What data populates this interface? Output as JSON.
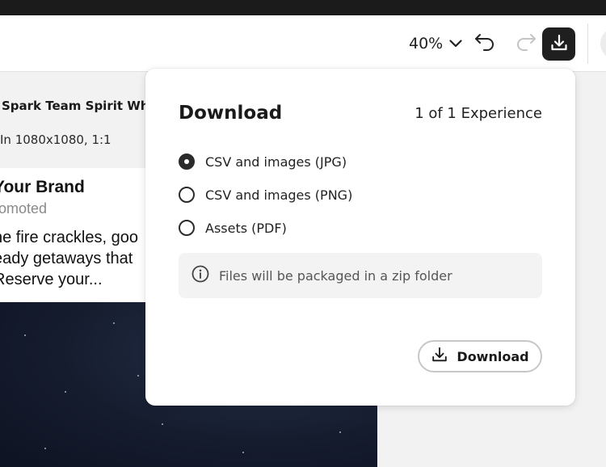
{
  "toolbar": {
    "zoom_value": "40%",
    "zoom_icon": "chevron-down-icon",
    "undo_icon": "undo-icon",
    "redo_icon": "redo-icon",
    "download_icon": "download-icon"
  },
  "canvas": {
    "design_title": "Spark Team Spirit Wher",
    "design_size": "In 1080x1080,  1:1",
    "post": {
      "brand": "Your Brand",
      "promoted": "romoted",
      "body_lines": [
        "he fire crackles, goo",
        "eady getaways that",
        " Reserve your..."
      ]
    }
  },
  "download_popover": {
    "title": "Download",
    "count": "1 of 1 Experience",
    "options": [
      {
        "label": "CSV and images (JPG)",
        "selected": true
      },
      {
        "label": "CSV and images (PNG)",
        "selected": false
      },
      {
        "label": "Assets (PDF)",
        "selected": false
      }
    ],
    "info_icon": "info-icon",
    "info_text": "Files will be packaged in a zip folder",
    "download_button_label": "Download"
  },
  "colors": {
    "toolbar_bg": "#ffffff",
    "download_button_bg": "#1f1f1f",
    "radio_selected": "#2b2b2b",
    "info_box_bg": "#f3f3f3"
  }
}
